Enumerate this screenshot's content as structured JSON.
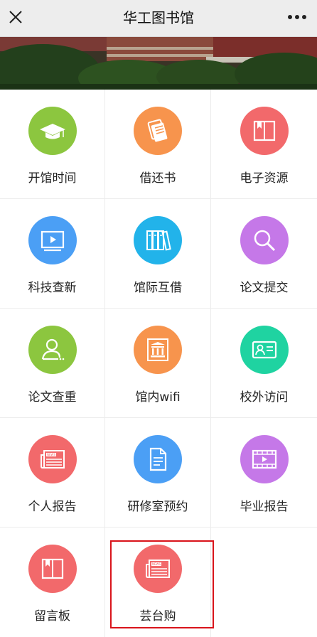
{
  "header": {
    "title": "华工图书馆"
  },
  "items": [
    {
      "label": "开馆时间",
      "icon": "graduation-cap-icon",
      "color": "#8cc63f"
    },
    {
      "label": "借还书",
      "icon": "book-stack-icon",
      "color": "#f7944d"
    },
    {
      "label": "电子资源",
      "icon": "open-book-icon",
      "color": "#f2696b"
    },
    {
      "label": "科技查新",
      "icon": "play-screen-icon",
      "color": "#4b9ff5"
    },
    {
      "label": "馆际互借",
      "icon": "bookshelf-icon",
      "color": "#22b3ea"
    },
    {
      "label": "论文提交",
      "icon": "magnifier-icon",
      "color": "#c578e8"
    },
    {
      "label": "论文查重",
      "icon": "user-profile-icon",
      "color": "#8cc63f"
    },
    {
      "label": "馆内wifi",
      "icon": "library-building-icon",
      "color": "#f7944d"
    },
    {
      "label": "校外访问",
      "icon": "id-card-icon",
      "color": "#1fd3a1"
    },
    {
      "label": "个人报告",
      "icon": "newspaper-icon",
      "color": "#f2696b"
    },
    {
      "label": "研修室预约",
      "icon": "document-icon",
      "color": "#4b9ff5"
    },
    {
      "label": "毕业报告",
      "icon": "video-film-icon",
      "color": "#c578e8"
    },
    {
      "label": "留言板",
      "icon": "open-book-icon",
      "color": "#f2696b"
    },
    {
      "label": "芸台购",
      "icon": "newspaper-icon",
      "color": "#f2696b"
    }
  ]
}
